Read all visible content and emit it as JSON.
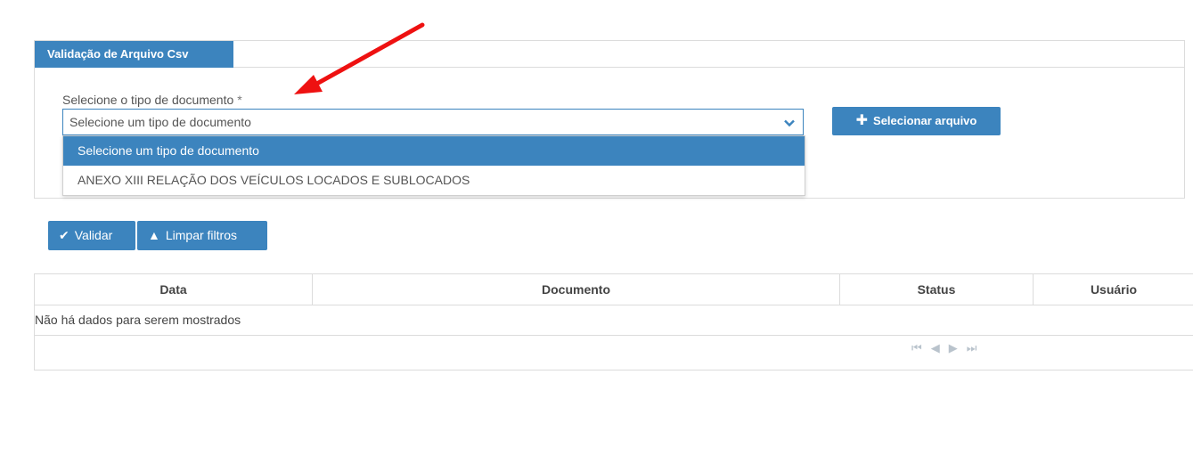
{
  "panel": {
    "tab_title": "Validação de Arquivo Csv",
    "field_label": "Selecione o tipo de documento",
    "required_mark": "*",
    "select_value": "Selecione um tipo de documento",
    "dropdown_options": [
      {
        "label": "Selecione um tipo de documento",
        "selected": true
      },
      {
        "label": "ANEXO XIII RELAÇÃO DOS VEÍCULOS LOCADOS E SUBLOCADOS",
        "selected": false
      }
    ],
    "file_button_label": "Selecionar arquivo"
  },
  "actions": {
    "validate_label": "Validar",
    "clear_label": "Limpar filtros"
  },
  "table": {
    "columns": [
      "Data",
      "Documento",
      "Status",
      "Usuário"
    ],
    "empty_message": "Não há dados para serem mostrados"
  },
  "colors": {
    "accent": "#3c84be",
    "annotation_arrow": "#ee1111"
  },
  "icons": {
    "chevron": "chevron-down-icon",
    "plus": "plus-icon",
    "check": "check-icon",
    "warning": "warning-icon",
    "pager": [
      "first-page-icon",
      "prev-page-icon",
      "next-page-icon",
      "last-page-icon"
    ]
  }
}
